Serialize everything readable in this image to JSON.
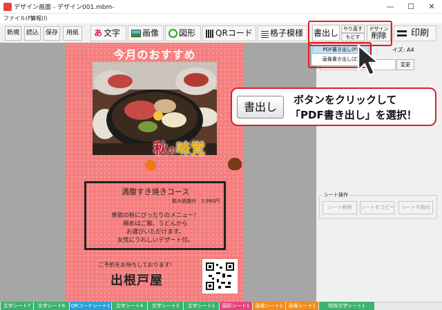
{
  "window": {
    "title": "デザイン画面 - デザイン001.mbm-",
    "controls": {
      "minimize": "—",
      "maximize": "☐",
      "close": "✕"
    }
  },
  "menu": {
    "file": "ファイル(F)",
    "info": "情報(I)"
  },
  "toolbar": {
    "new": "新規",
    "load": "読込",
    "save": "保存",
    "paper": "用紙",
    "text": "文字",
    "image": "画像",
    "shape": "図形",
    "qr": "QRコード",
    "pattern": "格子模様",
    "export": "書出し",
    "redo": "やり直す",
    "undo": "もどす",
    "design_top": "デザイン",
    "design_bottom": "削除",
    "print": "印刷"
  },
  "dropdown": {
    "pdf": "PDF書き出し(P)",
    "image": "画像書き出し(Z)"
  },
  "flyer": {
    "headline": "今月のおすすめ",
    "logo_main": "秋",
    "logo_small": "の",
    "logo_rest": "味覚",
    "course_title": "満腹すき焼きコース",
    "course_sub": "飲み放題付　3,980円",
    "desc": [
      "食欲の秋にぴったりのメニュー！",
      "締めはご飯、うどんから",
      "お選びいただけます。",
      "女性にうれしいデザート付。"
    ],
    "reserve": "ご予約をお待ちしております！",
    "shop": "出根戸屋"
  },
  "panel": {
    "size": "イズ: A4",
    "change": "変更",
    "sheet_group": "シート操作",
    "sheet_delete": "シート削除",
    "sheet_copy": "シートをコピー",
    "sheet_paste": "シートを貼付"
  },
  "callout": {
    "button": "書出し",
    "line1": "ボタンをクリックして",
    "line2": "「PDF書き出し」を選択！"
  },
  "tabs": [
    {
      "label": "文字シート7",
      "color": "#3cb371"
    },
    {
      "label": "文字シート6",
      "color": "#3cb371"
    },
    {
      "label": "QRコードシート1",
      "color": "#2a9fd6"
    },
    {
      "label": "文字シート4",
      "color": "#3cb371"
    },
    {
      "label": "文字シート3",
      "color": "#3cb371"
    },
    {
      "label": "文字シート1",
      "color": "#3cb371"
    },
    {
      "label": "図形シート1",
      "color": "#e0457b"
    },
    {
      "label": "画像シート2",
      "color": "#f08c1e"
    },
    {
      "label": "画像シート1",
      "color": "#f08c1e"
    },
    {
      "label": "特殊文字シート1",
      "color": "#3cb371"
    }
  ]
}
